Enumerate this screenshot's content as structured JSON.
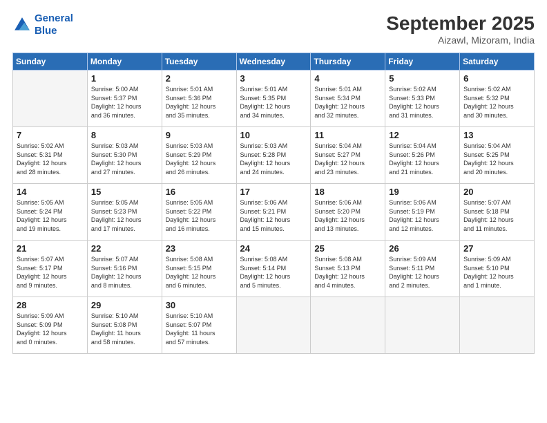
{
  "header": {
    "logo_line1": "General",
    "logo_line2": "Blue",
    "month": "September 2025",
    "location": "Aizawl, Mizoram, India"
  },
  "weekdays": [
    "Sunday",
    "Monday",
    "Tuesday",
    "Wednesday",
    "Thursday",
    "Friday",
    "Saturday"
  ],
  "weeks": [
    [
      {
        "day": "",
        "info": ""
      },
      {
        "day": "1",
        "info": "Sunrise: 5:00 AM\nSunset: 5:37 PM\nDaylight: 12 hours\nand 36 minutes."
      },
      {
        "day": "2",
        "info": "Sunrise: 5:01 AM\nSunset: 5:36 PM\nDaylight: 12 hours\nand 35 minutes."
      },
      {
        "day": "3",
        "info": "Sunrise: 5:01 AM\nSunset: 5:35 PM\nDaylight: 12 hours\nand 34 minutes."
      },
      {
        "day": "4",
        "info": "Sunrise: 5:01 AM\nSunset: 5:34 PM\nDaylight: 12 hours\nand 32 minutes."
      },
      {
        "day": "5",
        "info": "Sunrise: 5:02 AM\nSunset: 5:33 PM\nDaylight: 12 hours\nand 31 minutes."
      },
      {
        "day": "6",
        "info": "Sunrise: 5:02 AM\nSunset: 5:32 PM\nDaylight: 12 hours\nand 30 minutes."
      }
    ],
    [
      {
        "day": "7",
        "info": "Sunrise: 5:02 AM\nSunset: 5:31 PM\nDaylight: 12 hours\nand 28 minutes."
      },
      {
        "day": "8",
        "info": "Sunrise: 5:03 AM\nSunset: 5:30 PM\nDaylight: 12 hours\nand 27 minutes."
      },
      {
        "day": "9",
        "info": "Sunrise: 5:03 AM\nSunset: 5:29 PM\nDaylight: 12 hours\nand 26 minutes."
      },
      {
        "day": "10",
        "info": "Sunrise: 5:03 AM\nSunset: 5:28 PM\nDaylight: 12 hours\nand 24 minutes."
      },
      {
        "day": "11",
        "info": "Sunrise: 5:04 AM\nSunset: 5:27 PM\nDaylight: 12 hours\nand 23 minutes."
      },
      {
        "day": "12",
        "info": "Sunrise: 5:04 AM\nSunset: 5:26 PM\nDaylight: 12 hours\nand 21 minutes."
      },
      {
        "day": "13",
        "info": "Sunrise: 5:04 AM\nSunset: 5:25 PM\nDaylight: 12 hours\nand 20 minutes."
      }
    ],
    [
      {
        "day": "14",
        "info": "Sunrise: 5:05 AM\nSunset: 5:24 PM\nDaylight: 12 hours\nand 19 minutes."
      },
      {
        "day": "15",
        "info": "Sunrise: 5:05 AM\nSunset: 5:23 PM\nDaylight: 12 hours\nand 17 minutes."
      },
      {
        "day": "16",
        "info": "Sunrise: 5:05 AM\nSunset: 5:22 PM\nDaylight: 12 hours\nand 16 minutes."
      },
      {
        "day": "17",
        "info": "Sunrise: 5:06 AM\nSunset: 5:21 PM\nDaylight: 12 hours\nand 15 minutes."
      },
      {
        "day": "18",
        "info": "Sunrise: 5:06 AM\nSunset: 5:20 PM\nDaylight: 12 hours\nand 13 minutes."
      },
      {
        "day": "19",
        "info": "Sunrise: 5:06 AM\nSunset: 5:19 PM\nDaylight: 12 hours\nand 12 minutes."
      },
      {
        "day": "20",
        "info": "Sunrise: 5:07 AM\nSunset: 5:18 PM\nDaylight: 12 hours\nand 11 minutes."
      }
    ],
    [
      {
        "day": "21",
        "info": "Sunrise: 5:07 AM\nSunset: 5:17 PM\nDaylight: 12 hours\nand 9 minutes."
      },
      {
        "day": "22",
        "info": "Sunrise: 5:07 AM\nSunset: 5:16 PM\nDaylight: 12 hours\nand 8 minutes."
      },
      {
        "day": "23",
        "info": "Sunrise: 5:08 AM\nSunset: 5:15 PM\nDaylight: 12 hours\nand 6 minutes."
      },
      {
        "day": "24",
        "info": "Sunrise: 5:08 AM\nSunset: 5:14 PM\nDaylight: 12 hours\nand 5 minutes."
      },
      {
        "day": "25",
        "info": "Sunrise: 5:08 AM\nSunset: 5:13 PM\nDaylight: 12 hours\nand 4 minutes."
      },
      {
        "day": "26",
        "info": "Sunrise: 5:09 AM\nSunset: 5:11 PM\nDaylight: 12 hours\nand 2 minutes."
      },
      {
        "day": "27",
        "info": "Sunrise: 5:09 AM\nSunset: 5:10 PM\nDaylight: 12 hours\nand 1 minute."
      }
    ],
    [
      {
        "day": "28",
        "info": "Sunrise: 5:09 AM\nSunset: 5:09 PM\nDaylight: 12 hours\nand 0 minutes."
      },
      {
        "day": "29",
        "info": "Sunrise: 5:10 AM\nSunset: 5:08 PM\nDaylight: 11 hours\nand 58 minutes."
      },
      {
        "day": "30",
        "info": "Sunrise: 5:10 AM\nSunset: 5:07 PM\nDaylight: 11 hours\nand 57 minutes."
      },
      {
        "day": "",
        "info": ""
      },
      {
        "day": "",
        "info": ""
      },
      {
        "day": "",
        "info": ""
      },
      {
        "day": "",
        "info": ""
      }
    ]
  ]
}
